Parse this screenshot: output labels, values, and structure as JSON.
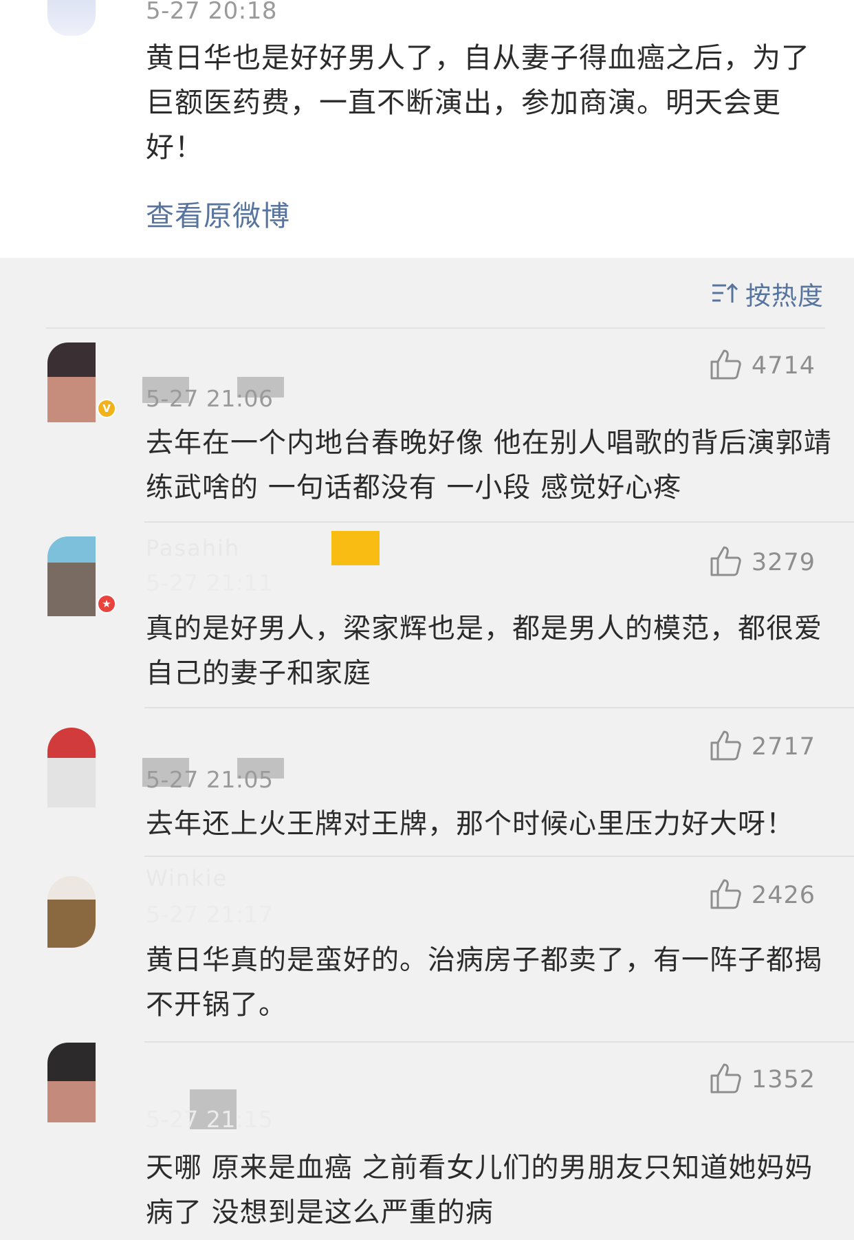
{
  "post": {
    "time": "5-27 20:18",
    "text": "黄日华也是好好男人了，自从妻子得血癌之后，为了巨额医药费，一直不断演出，参加商演。明天会更好！",
    "view_original": "查看原微博"
  },
  "sort": {
    "icon": "sort-icon",
    "label": "按热度"
  },
  "colors": {
    "link": "#56749e",
    "text": "#2b2b2b",
    "meta": "#9a9a9a",
    "background": "#f1f1f1",
    "verified_gold": "#f2b21c",
    "verified_red": "#e8433d"
  },
  "comments": [
    {
      "time": "5-27 21:06",
      "likes": "4714",
      "badge": "gold-v",
      "text": "去年在一个内地台春晚好像 他在别人唱歌的背后演郭靖练武啥的 一句话都没有 一小段 感觉好心疼"
    },
    {
      "username": "Pasahih",
      "time": "5-27 21:11",
      "likes": "3279",
      "badge": "red-star",
      "text": "真的是好男人，梁家辉也是，都是男人的模范，都很爱自己的妻子和家庭"
    },
    {
      "time": "5-27 21:05",
      "likes": "2717",
      "text": "去年还上火王牌对王牌，那个时候心里压力好大呀！"
    },
    {
      "username": "Winkie",
      "time": "5-27 21:17",
      "likes": "2426",
      "text": "黄日华真的是蛮好的。治病房子都卖了，有一阵子都揭不开锅了。"
    },
    {
      "time": "5-27 21:15",
      "likes": "1352",
      "text": "天哪 原来是血癌 之前看女儿们的男朋友只知道她妈妈病了 没想到是这么严重的病"
    }
  ]
}
